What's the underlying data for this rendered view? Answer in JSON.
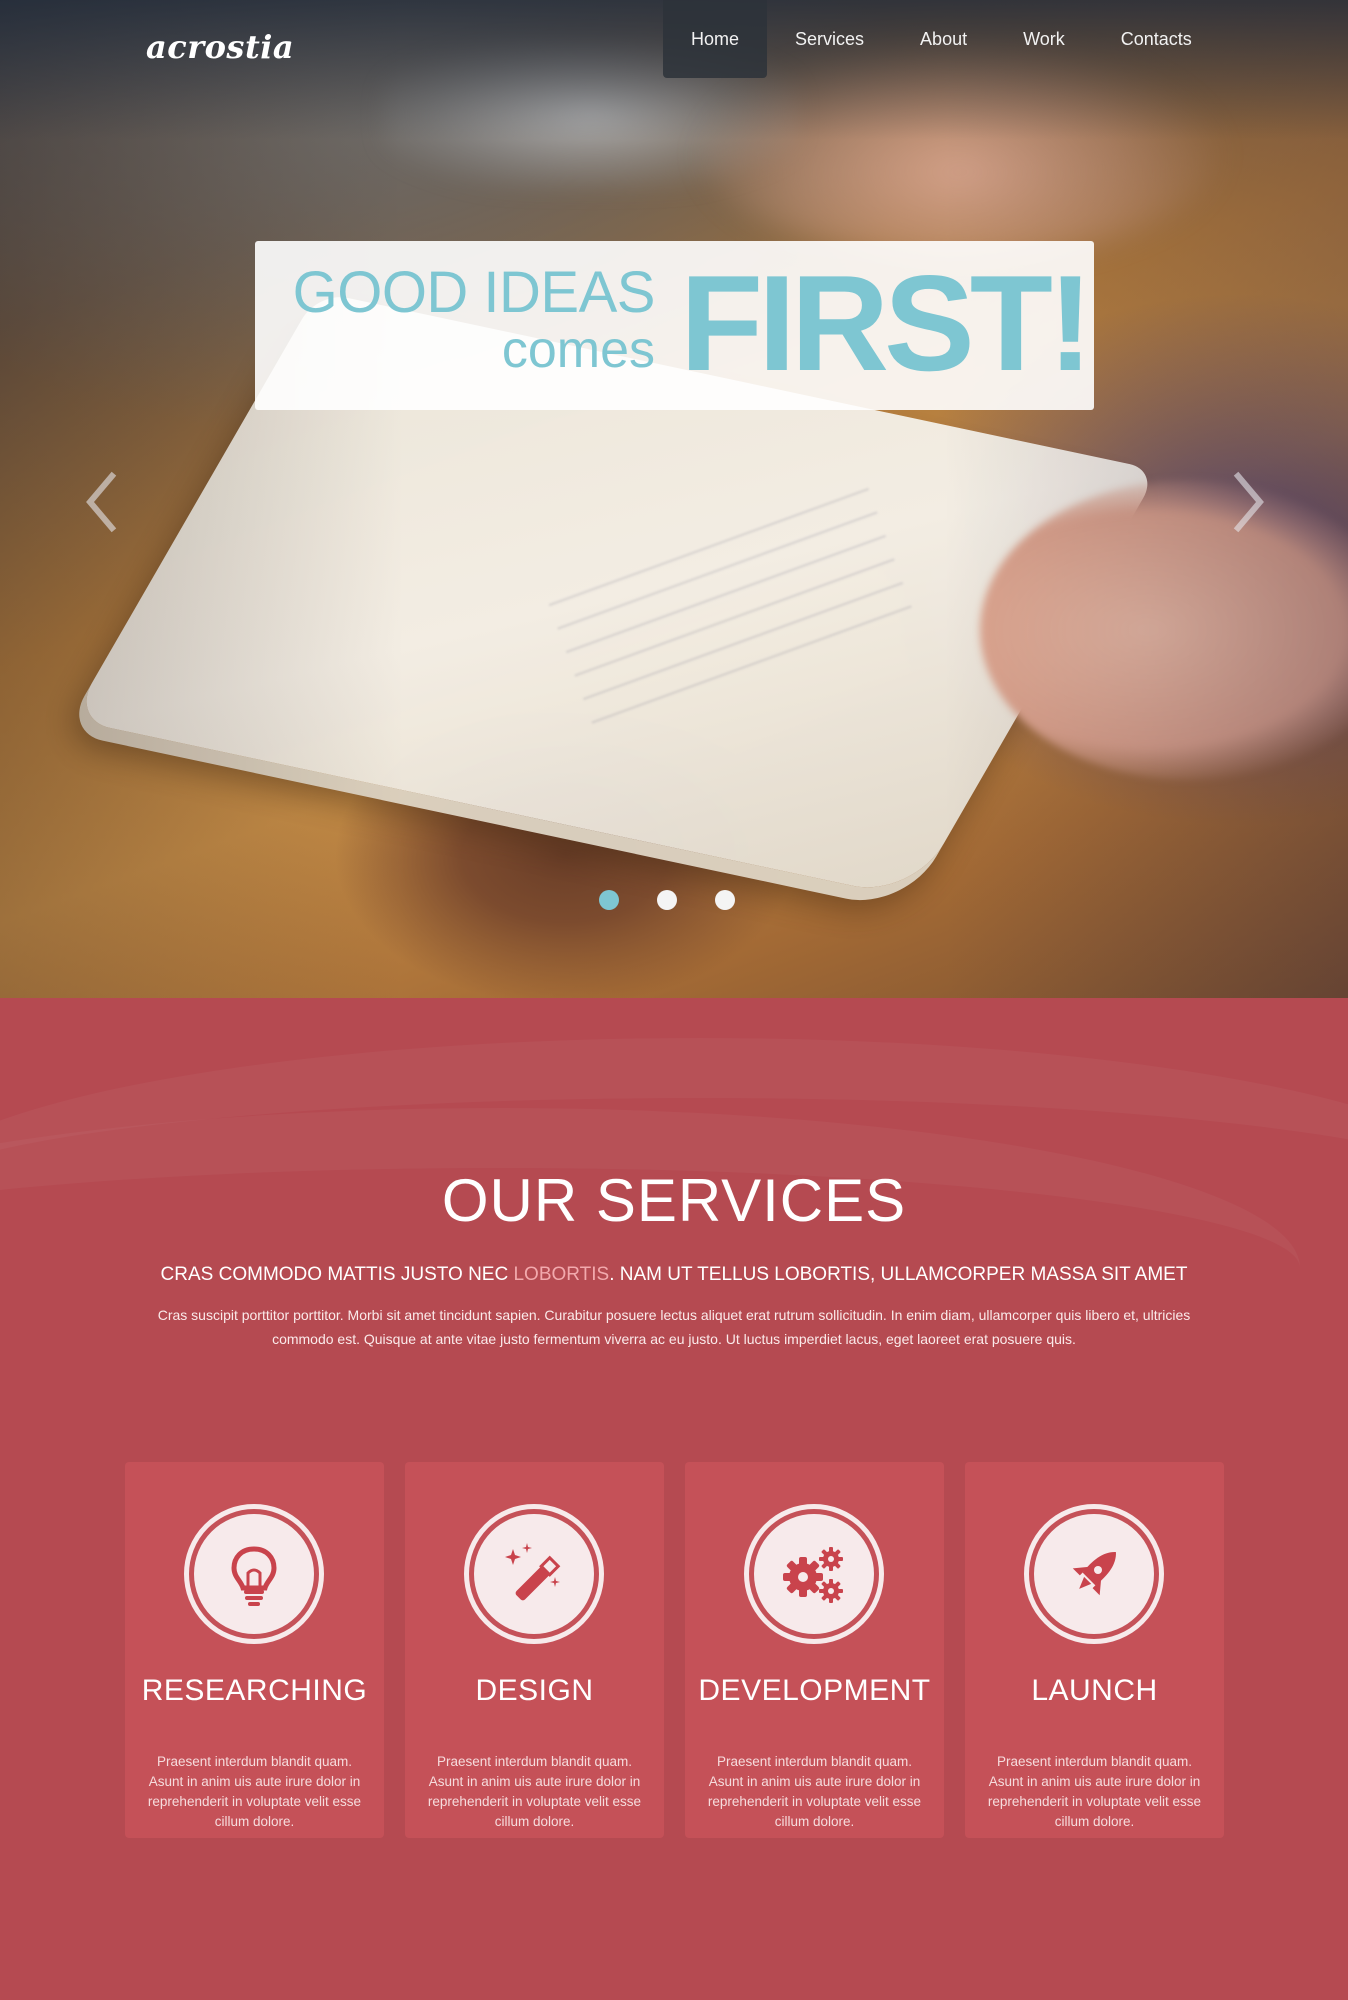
{
  "brand": {
    "logo": "acrostia"
  },
  "nav": {
    "items": [
      {
        "label": "Home",
        "active": true
      },
      {
        "label": "Services"
      },
      {
        "label": "About"
      },
      {
        "label": "Work"
      },
      {
        "label": "Contacts"
      }
    ]
  },
  "hero": {
    "line1": "GOOD IDEAS",
    "line2": "comes",
    "highlight": "FIRST!",
    "accent_color": "#7ec6d2",
    "prev_icon": "chevron-left-icon",
    "next_icon": "chevron-right-icon",
    "slides": {
      "count": 3,
      "active": 1
    }
  },
  "services": {
    "title": "OUR SERVICES",
    "subtitle_before": "CRAS COMMODO MATTIS JUSTO NEC ",
    "subtitle_accent": "LOBORTIS",
    "subtitle_after": ". NAM UT TELLUS LOBORTIS, ULLAMCORPER MASSA SIT AMET",
    "description": "Cras suscipit porttitor porttitor. Morbi sit amet tincidunt sapien. Curabitur posuere lectus aliquet erat rutrum sollicitudin. In enim diam, ullamcorper quis libero et, ultricies commodo est. Quisque at ante vitae justo fermentum viverra ac eu justo. Ut luctus imperdiet lacus, eget laoreet erat posuere quis.",
    "background_color": "#b54a51",
    "cards": [
      {
        "title": "RESEARCHING",
        "icon": "lightbulb-icon",
        "text": "Praesent interdum blandit quam. Asunt in anim uis aute irure dolor in reprehenderit in voluptate velit esse cillum dolore."
      },
      {
        "title": "DESIGN",
        "icon": "magic-wand-icon",
        "text": "Praesent interdum blandit quam. Asunt in anim uis aute irure dolor in reprehenderit in voluptate velit esse cillum dolore."
      },
      {
        "title": "DEVELOPMENT",
        "icon": "gears-icon",
        "text": "Praesent interdum blandit quam. Asunt in anim uis aute irure dolor in reprehenderit in voluptate velit esse cillum dolore."
      },
      {
        "title": "LAUNCH",
        "icon": "rocket-icon",
        "text": "Praesent interdum blandit quam. Asunt in anim uis aute irure dolor in reprehenderit in voluptate velit esse cillum dolore."
      }
    ]
  }
}
